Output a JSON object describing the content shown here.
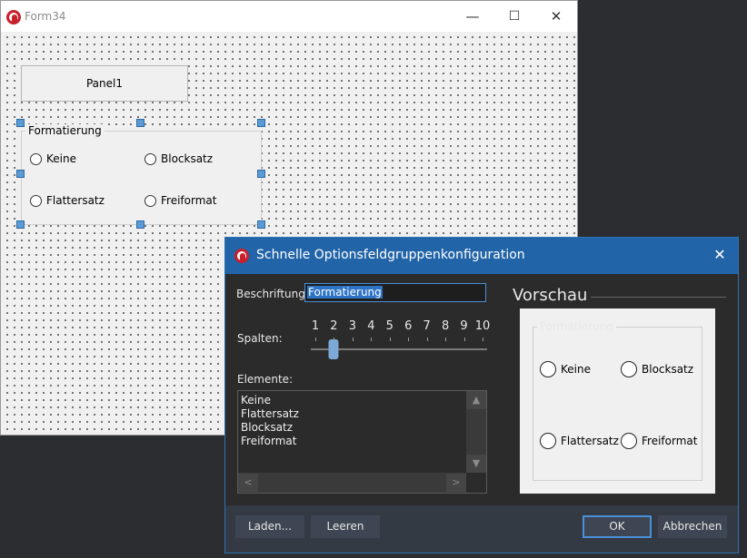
{
  "form": {
    "title": "Form34",
    "panel_caption": "Panel1",
    "group": {
      "caption": "Formatierung",
      "options": [
        "Keine",
        "Blocksatz",
        "Flattersatz",
        "Freiformat"
      ]
    }
  },
  "window_controls": {
    "minimize": "—",
    "maximize": "☐",
    "close": "✕"
  },
  "dialog": {
    "title": "Schnelle Optionsfeldgruppenkonfiguration",
    "close_glyph": "✕",
    "caption_label": "Beschriftung:",
    "caption_value": "Formatierung",
    "columns_label": "Spalten:",
    "column_numbers": [
      "1",
      "2",
      "3",
      "4",
      "5",
      "6",
      "7",
      "8",
      "9",
      "10"
    ],
    "columns_selected": 2,
    "elements_label": "Elemente:",
    "elements": [
      "Keine",
      "Flattersatz",
      "Blocksatz",
      "Freiformat"
    ],
    "scroll_up": "▲",
    "scroll_down": "▼",
    "scroll_left": "<",
    "scroll_right": ">",
    "preview_heading": "Vorschau",
    "preview": {
      "caption": "Formatierung",
      "options": [
        "Keine",
        "Blocksatz",
        "Flattersatz",
        "Freiformat"
      ]
    },
    "buttons": {
      "load": "Laden...",
      "clear": "Leeren",
      "ok": "OK",
      "cancel": "Abbrechen"
    }
  },
  "colors": {
    "dialog_titlebar": "#2264a8",
    "dialog_background": "#2b2b2b",
    "selection_handle": "#5b9bd5",
    "accent_border": "#4a90d9"
  }
}
